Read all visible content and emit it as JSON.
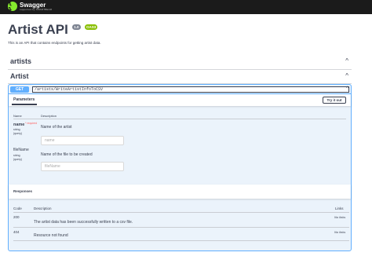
{
  "topbar": {
    "logo_glyph": "{ }",
    "logo_name": "Swagger",
    "logo_sub": "supported by SMARTBEAR"
  },
  "info": {
    "title": "Artist API",
    "version_badge": "1.0",
    "oas_badge": "OAS3",
    "description": "This is an API that contains endpoints for getting artist data."
  },
  "sections": [
    {
      "title": "artists",
      "chevron": "^"
    },
    {
      "title": "Artist",
      "chevron": "^"
    }
  ],
  "operation": {
    "method": "GET",
    "path": "/artists/WriteArtistInfoToCSV",
    "chevron": "^",
    "parameters_tab": "Parameters",
    "try_label": "Try it out",
    "columns": {
      "name": "Name",
      "description": "Description"
    },
    "params": [
      {
        "name": "name",
        "required": "* required",
        "type": "string",
        "location": "(query)",
        "description": "Name of the artist",
        "placeholder": "name"
      },
      {
        "name": "fileName",
        "required": "",
        "type": "string",
        "location": "(query)",
        "description": "Name of the file to be created",
        "placeholder": "fileName"
      }
    ],
    "responses_title": "Responses",
    "response_columns": {
      "code": "Code",
      "description": "Description",
      "links": "Links"
    },
    "responses": [
      {
        "code": "200",
        "description": "The artist data has been successfully written to a csv file.",
        "links": "No links"
      },
      {
        "code": "404",
        "description": "Resource not found",
        "links": "No links"
      }
    ]
  },
  "colors": {
    "get_accent": "#61affe",
    "topbar": "#1b1b1b",
    "logo": "#85ea2d",
    "oas_badge": "#89bf04"
  }
}
